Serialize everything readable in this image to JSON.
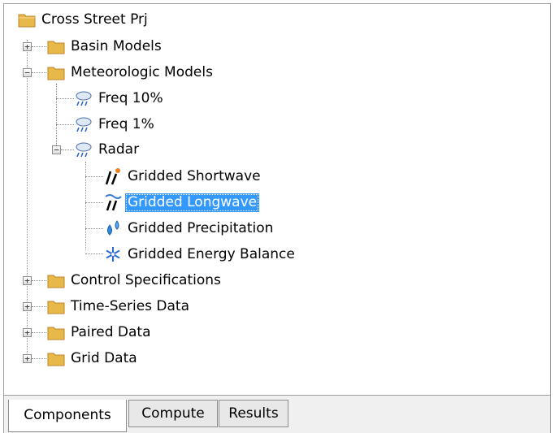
{
  "tree": {
    "root": {
      "label": "Cross Street Prj",
      "icon": "folder-icon"
    },
    "basin_models": {
      "label": "Basin Models",
      "icon": "folder-icon",
      "expander": "+"
    },
    "meteorologic_models": {
      "label": "Meteorologic Models",
      "icon": "folder-icon",
      "expander": "−"
    },
    "met_items": [
      {
        "label": "Freq 10%",
        "icon": "weather-icon"
      },
      {
        "label": "Freq 1%",
        "icon": "weather-icon"
      },
      {
        "label": "Radar",
        "icon": "weather-icon",
        "expander": "−"
      }
    ],
    "radar_children": [
      {
        "label": "Gridded Shortwave",
        "icon": "shortwave-icon"
      },
      {
        "label": "Gridded Longwave",
        "icon": "longwave-icon",
        "selected": true
      },
      {
        "label": "Gridded Precipitation",
        "icon": "precipitation-icon"
      },
      {
        "label": "Gridded Energy Balance",
        "icon": "snowflake-icon"
      }
    ],
    "control_specifications": {
      "label": "Control Specifications",
      "icon": "folder-icon",
      "expander": "+"
    },
    "time_series_data": {
      "label": "Time-Series Data",
      "icon": "folder-icon",
      "expander": "+"
    },
    "paired_data": {
      "label": "Paired Data",
      "icon": "folder-icon",
      "expander": "+"
    },
    "grid_data": {
      "label": "Grid Data",
      "icon": "folder-icon",
      "expander": "+"
    }
  },
  "tabs": [
    {
      "label": "Components",
      "active": true
    },
    {
      "label": "Compute",
      "active": false
    },
    {
      "label": "Results",
      "active": false
    }
  ],
  "colors": {
    "selection": "#3399ff",
    "folder": "#e8b84a"
  }
}
